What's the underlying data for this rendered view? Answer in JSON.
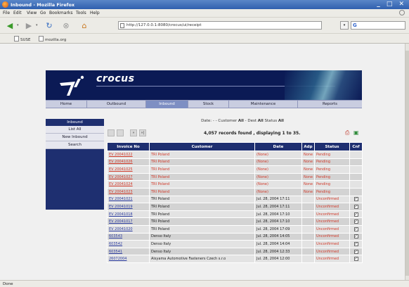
{
  "window": {
    "title": "Inbound - Mozilla Firefox"
  },
  "menu": [
    "File",
    "Edit",
    "View",
    "Go",
    "Bookmarks",
    "Tools",
    "Help"
  ],
  "urlbar": {
    "url": "http://127.0.0.1:8080/crocus/ui/receipt"
  },
  "bookmarks": [
    "SUSE",
    "mozilla.org"
  ],
  "brand": "crocus",
  "nav": [
    "Home",
    "Outbound",
    "Inbound",
    "Stock",
    "Maintenance",
    "Reports"
  ],
  "nav_active": "Inbound",
  "sidebar": {
    "header": "Inbound",
    "items": [
      "List All",
      "New Inbound",
      "Search"
    ]
  },
  "filter": {
    "date_label": "Date:",
    "date_value": "-",
    "customer_label": "- Customer",
    "customer_value": "All",
    "dest_label": "- Dest",
    "dest_value": "All",
    "status_label": "Status",
    "status_value": "All"
  },
  "pager": {
    "records": "4,057 records found , displaying 1 to 35."
  },
  "table": {
    "headers": [
      "Invoice No",
      "Customer",
      "Date",
      "Adp",
      "Status",
      "Cnf"
    ],
    "rows": [
      {
        "invoice": "EV 20041022",
        "customer": "TRI Poland",
        "date": "(None)",
        "adp": "None",
        "status": "Pending",
        "checked": false,
        "pending": true
      },
      {
        "invoice": "EV 20041026",
        "customer": "TRI Poland",
        "date": "(None)",
        "adp": "None",
        "status": "Pending",
        "checked": false,
        "pending": true
      },
      {
        "invoice": "EV 20041025",
        "customer": "TRI Poland",
        "date": "(None)",
        "adp": "None",
        "status": "Pending",
        "checked": false,
        "pending": true
      },
      {
        "invoice": "EV 20041027",
        "customer": "TRI Poland",
        "date": "(None)",
        "adp": "None",
        "status": "Pending",
        "checked": false,
        "pending": true
      },
      {
        "invoice": "EV 20041024",
        "customer": "TRI Poland",
        "date": "(None)",
        "adp": "None",
        "status": "Pending",
        "checked": false,
        "pending": true
      },
      {
        "invoice": "EV 20041023",
        "customer": "TRI Poland",
        "date": "(None)",
        "adp": "None",
        "status": "Pending",
        "checked": false,
        "pending": true
      },
      {
        "invoice": "EV 20041021",
        "customer": "TRI Poland",
        "date": "Jul. 28, 2004 17:11",
        "adp": "",
        "status": "Unconfirmed",
        "checked": true,
        "pending": false
      },
      {
        "invoice": "EV 20041019",
        "customer": "TRI Poland",
        "date": "Jul. 28, 2004 17:11",
        "adp": "",
        "status": "Unconfirmed",
        "checked": true,
        "pending": false
      },
      {
        "invoice": "EV 20041018",
        "customer": "TRI Poland",
        "date": "Jul. 28, 2004 17:10",
        "adp": "",
        "status": "Unconfirmed",
        "checked": true,
        "pending": false
      },
      {
        "invoice": "EV 20041017",
        "customer": "TRI Poland",
        "date": "Jul. 28, 2004 17:10",
        "adp": "",
        "status": "Unconfirmed",
        "checked": true,
        "pending": false
      },
      {
        "invoice": "EV 20041020",
        "customer": "TRI Poland",
        "date": "Jul. 28, 2004 17:09",
        "adp": "",
        "status": "Unconfirmed",
        "checked": true,
        "pending": false
      },
      {
        "invoice": "603543",
        "customer": "Denso Italy",
        "date": "Jul. 28, 2004 14:05",
        "adp": "",
        "status": "Unconfirmed",
        "checked": true,
        "pending": false
      },
      {
        "invoice": "603542",
        "customer": "Denso Italy",
        "date": "Jul. 28, 2004 14:04",
        "adp": "",
        "status": "Unconfirmed",
        "checked": true,
        "pending": false
      },
      {
        "invoice": "603541",
        "customer": "Denso Italy",
        "date": "Jul. 28, 2004 12:33",
        "adp": "",
        "status": "Unconfirmed",
        "checked": true,
        "pending": false
      },
      {
        "invoice": "26072004",
        "customer": "Aisyama Automotive Fasteners Czech s.r.o",
        "date": "Jul. 28, 2004 12:00",
        "adp": "",
        "status": "Unconfirmed",
        "checked": true,
        "pending": false
      }
    ]
  },
  "status_bar": "Done",
  "colors": {
    "navy": "#1e2f70",
    "pending": "#d23a2a",
    "link": "#2b3ca0"
  }
}
